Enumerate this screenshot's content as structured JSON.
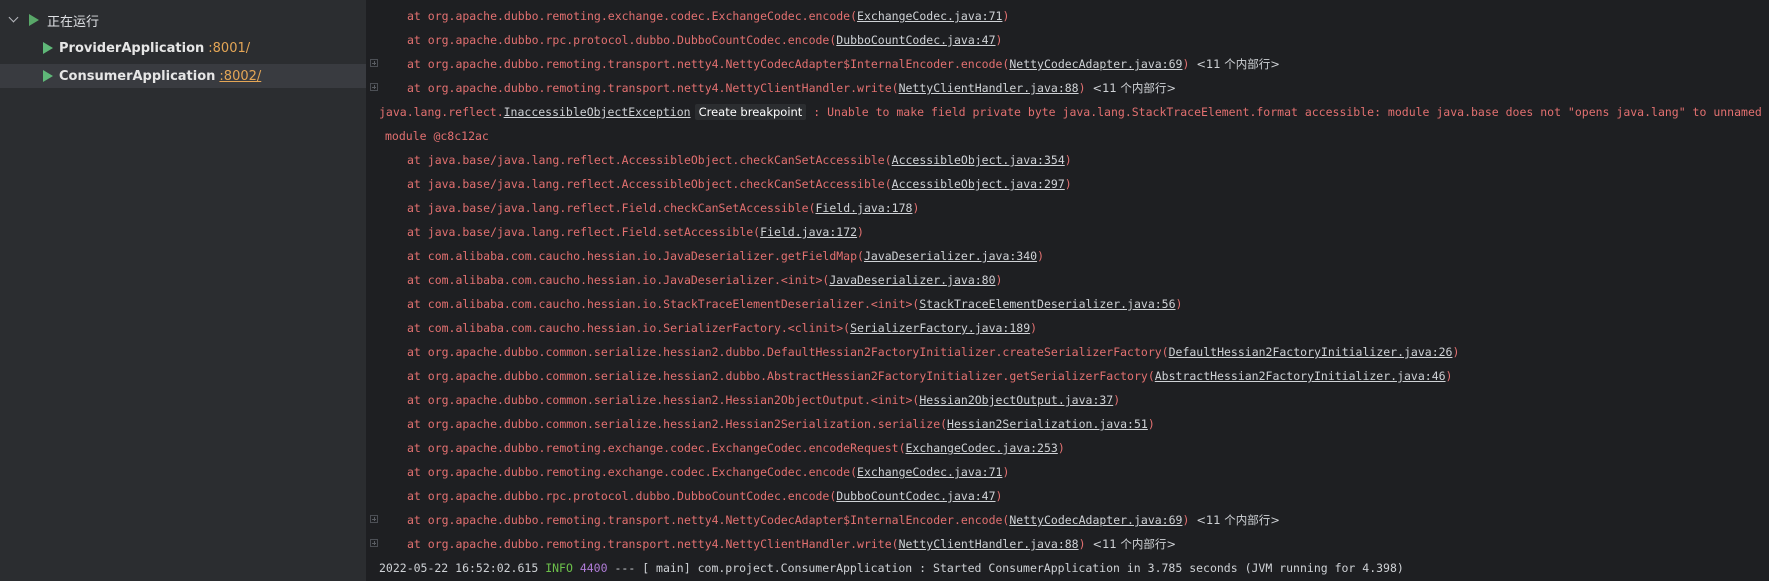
{
  "sidebar": {
    "group_label": "正在运行",
    "apps": [
      {
        "name": "ProviderApplication",
        "port": ":8001/"
      },
      {
        "name": "ConsumerApplication",
        "port": ":8002/"
      }
    ]
  },
  "console": {
    "frames_top": [
      {
        "prefix": "at org.apache.dubbo.remoting.exchange.codec.ExchangeCodec.encode(",
        "link": "ExchangeCodec.java:71",
        "suffix": ")",
        "folded": ""
      },
      {
        "prefix": "at org.apache.dubbo.rpc.protocol.dubbo.DubboCountCodec.encode(",
        "link": "DubboCountCodec.java:47",
        "suffix": ")",
        "folded": ""
      },
      {
        "prefix": "at org.apache.dubbo.remoting.transport.netty4.NettyCodecAdapter$InternalEncoder.encode(",
        "link": "NettyCodecAdapter.java:69",
        "suffix": ")",
        "folded": "<11 个内部行>"
      },
      {
        "prefix": "at org.apache.dubbo.remoting.transport.netty4.NettyClientHandler.write(",
        "link": "NettyClientHandler.java:88",
        "suffix": ")",
        "folded": "<11 个内部行>"
      }
    ],
    "exception": {
      "prefix": "java.lang.reflect.",
      "class_link": "InaccessibleObjectException",
      "breakpoint_label": "Create breakpoint",
      "message": ": Unable to make field private byte java.lang.StackTraceElement.format accessible: module java.base does not \"opens java.lang\" to unnamed",
      "continuation": "module @c8c12ac"
    },
    "frames": [
      {
        "prefix": "at java.base/java.lang.reflect.AccessibleObject.checkCanSetAccessible(",
        "link": "AccessibleObject.java:354",
        "suffix": ")",
        "folded": ""
      },
      {
        "prefix": "at java.base/java.lang.reflect.AccessibleObject.checkCanSetAccessible(",
        "link": "AccessibleObject.java:297",
        "suffix": ")",
        "folded": ""
      },
      {
        "prefix": "at java.base/java.lang.reflect.Field.checkCanSetAccessible(",
        "link": "Field.java:178",
        "suffix": ")",
        "folded": ""
      },
      {
        "prefix": "at java.base/java.lang.reflect.Field.setAccessible(",
        "link": "Field.java:172",
        "suffix": ")",
        "folded": ""
      },
      {
        "prefix": "at com.alibaba.com.caucho.hessian.io.JavaDeserializer.getFieldMap(",
        "link": "JavaDeserializer.java:340",
        "suffix": ")",
        "folded": ""
      },
      {
        "prefix": "at com.alibaba.com.caucho.hessian.io.JavaDeserializer.<init>(",
        "link": "JavaDeserializer.java:80",
        "suffix": ")",
        "folded": ""
      },
      {
        "prefix": "at com.alibaba.com.caucho.hessian.io.StackTraceElementDeserializer.<init>(",
        "link": "StackTraceElementDeserializer.java:56",
        "suffix": ")",
        "folded": ""
      },
      {
        "prefix": "at com.alibaba.com.caucho.hessian.io.SerializerFactory.<clinit>(",
        "link": "SerializerFactory.java:189",
        "suffix": ")",
        "folded": ""
      },
      {
        "prefix": "at org.apache.dubbo.common.serialize.hessian2.dubbo.DefaultHessian2FactoryInitializer.createSerializerFactory(",
        "link": "DefaultHessian2FactoryInitializer.java:26",
        "suffix": ")",
        "folded": ""
      },
      {
        "prefix": "at org.apache.dubbo.common.serialize.hessian2.dubbo.AbstractHessian2FactoryInitializer.getSerializerFactory(",
        "link": "AbstractHessian2FactoryInitializer.java:46",
        "suffix": ")",
        "folded": ""
      },
      {
        "prefix": "at org.apache.dubbo.common.serialize.hessian2.Hessian2ObjectOutput.<init>(",
        "link": "Hessian2ObjectOutput.java:37",
        "suffix": ")",
        "folded": ""
      },
      {
        "prefix": "at org.apache.dubbo.common.serialize.hessian2.Hessian2Serialization.serialize(",
        "link": "Hessian2Serialization.java:51",
        "suffix": ")",
        "folded": ""
      },
      {
        "prefix": "at org.apache.dubbo.remoting.exchange.codec.ExchangeCodec.encodeRequest(",
        "link": "ExchangeCodec.java:253",
        "suffix": ")",
        "folded": ""
      },
      {
        "prefix": "at org.apache.dubbo.remoting.exchange.codec.ExchangeCodec.encode(",
        "link": "ExchangeCodec.java:71",
        "suffix": ")",
        "folded": ""
      },
      {
        "prefix": "at org.apache.dubbo.rpc.protocol.dubbo.DubboCountCodec.encode(",
        "link": "DubboCountCodec.java:47",
        "suffix": ")",
        "folded": ""
      },
      {
        "prefix": "at org.apache.dubbo.remoting.transport.netty4.NettyCodecAdapter$InternalEncoder.encode(",
        "link": "NettyCodecAdapter.java:69",
        "suffix": ")",
        "folded": "<11 个内部行>"
      },
      {
        "prefix": "at org.apache.dubbo.remoting.transport.netty4.NettyClientHandler.write(",
        "link": "NettyClientHandler.java:88",
        "suffix": ")",
        "folded": "<11 个内部行>"
      }
    ],
    "log": {
      "timestamp": "2022-05-22 16:52:02.615",
      "level": "INFO",
      "pid": "4400",
      "separator": "---",
      "thread": "[           main]",
      "logger": "com.project.ConsumerApplication",
      "message": ": Started ConsumerApplication in 3.785 seconds (JVM running for 4.398)"
    }
  }
}
